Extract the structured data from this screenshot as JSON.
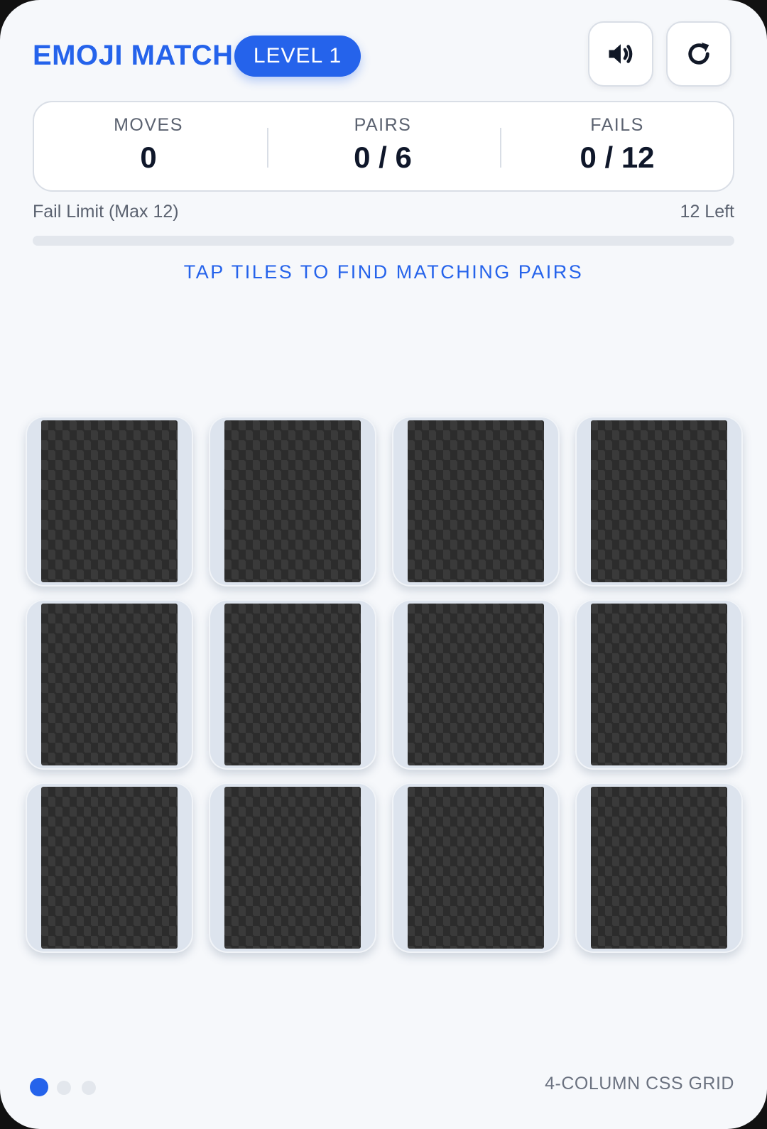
{
  "header": {
    "title": "EMOJI MATCH",
    "level": "LEVEL 1",
    "sound_icon": "speaker-icon",
    "restart_icon": "restart-icon"
  },
  "stats": {
    "moves_label": "MOVES",
    "moves_value": "0",
    "pairs_label": "PAIRS",
    "pairs_value": "0 / 6",
    "fails_label": "FAILS",
    "fails_value": "0 / 12"
  },
  "fail_limit": {
    "label": "Fail Limit (Max 12)",
    "remaining": "12 Left",
    "progress_fraction": 0
  },
  "instruction": "TAP TILES TO FIND MATCHING PAIRS",
  "board": {
    "columns": 4,
    "rows": 3,
    "tile_count": 12,
    "tile_state": "face-down"
  },
  "pagination": {
    "total": 3,
    "active_index": 0
  },
  "footer": {
    "label": "4-COLUMN CSS GRID"
  },
  "colors": {
    "accent": "#2563eb",
    "background": "#f6f8fb",
    "tile_back": "#3a3a3a"
  }
}
